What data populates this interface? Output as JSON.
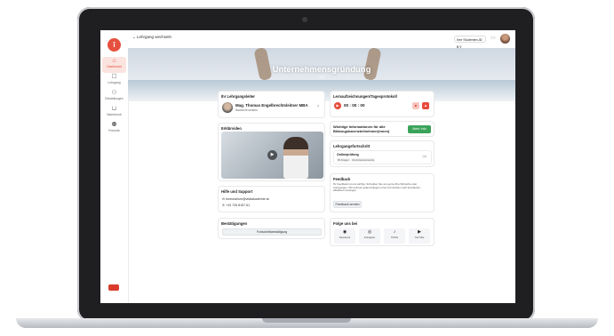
{
  "sidebar": {
    "items": [
      {
        "label": "Dashboard",
        "icon": "home-icon"
      },
      {
        "label": "Lehrgang",
        "icon": "book-icon"
      },
      {
        "label": "Einstellungen",
        "icon": "users-icon"
      },
      {
        "label": "Warenkorb",
        "icon": "cart-icon"
      },
      {
        "label": "Freunde",
        "icon": "friends-icon"
      }
    ]
  },
  "header": {
    "course_switch": "Lehrgang wechseln",
    "student_id_label": "Ihre Studenten-ID:",
    "student_id_value": "0"
  },
  "hero": {
    "title": "Unternehmensgründung",
    "subtitle": "B.S"
  },
  "instructor": {
    "title": "Ihr Lehrgangsleiter",
    "name": "Mag. Thomas Engelbrechtsleitner MBA",
    "sub": "Nachricht senden"
  },
  "video": {
    "title": "Erklärvideo"
  },
  "support": {
    "title": "Hilfe und Support",
    "email": "formularium@vitalakademie.at",
    "phone": "+43 726 8157 61"
  },
  "confirmations": {
    "title": "Bestätigungen",
    "button": "Fortschrittsbestätigung"
  },
  "log": {
    "title": "Lernaufzeichnungen/Tagesprotokoll",
    "time": "00 : 00 : 00"
  },
  "info": {
    "text": "Wichtige Informationen für alle Bildungskarenzteilnehmer(innen)",
    "button": "Mehr Info"
  },
  "progress": {
    "title": "Lehrgangsfortschritt",
    "item": "Onlineprüfung",
    "tag1": "50 Fragen",
    "tag2": "3/4 Antwortversuche",
    "count": "0"
  },
  "feedback": {
    "title": "Feedback",
    "text": "Ihr Feedback ist uns wichtig. Schreiben Sie uns gerne Ihre Wünsche oder Anregungen. Wir nehmen jedes Anliegen ernst und streben nach konstanten, effektiven Lösungen.",
    "button": "Feedback senden"
  },
  "social": {
    "title": "Folge uns bei",
    "items": [
      {
        "label": "Facebook",
        "icon": "facebook-icon"
      },
      {
        "label": "Instagram",
        "icon": "instagram-icon"
      },
      {
        "label": "TikTok",
        "icon": "tiktok-icon"
      },
      {
        "label": "YouTube",
        "icon": "youtube-icon"
      }
    ]
  },
  "colors": {
    "accent": "#e6503e",
    "green": "#3aa35a",
    "red": "#e64b3c"
  }
}
